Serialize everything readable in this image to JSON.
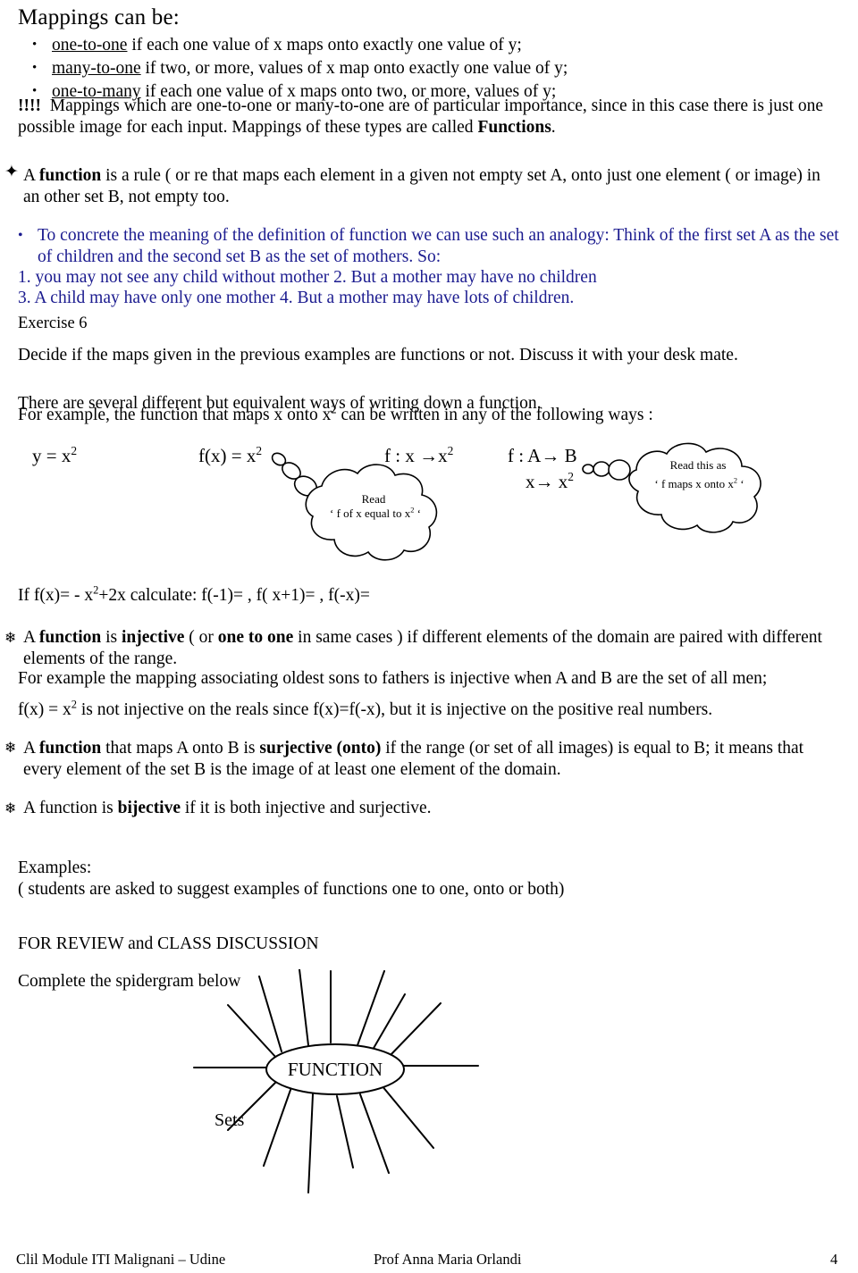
{
  "document": {
    "heading": "Mappings can be:",
    "mapping_bullets": [
      {
        "term": "one-to-one",
        "rest": " if each one value of x maps onto exactly one value of y;"
      },
      {
        "term": "many-to-one",
        "rest": " if two, or more, values of x map onto exactly one value of y;"
      },
      {
        "term": "one-to-many",
        "rest": " if each one value of x maps onto two, or more, values of y;"
      }
    ],
    "importance_note": {
      "prefix": "!!!!",
      "text_a": "Mappings which are one-to-one or many-to-one are of particular importance, since in this case there is just one possible image for each input. Mappings of these types are called ",
      "bold_word": "Functions",
      "text_b": "."
    },
    "function_definition": {
      "marker": "star-icon",
      "lead": "A ",
      "bold_word": "function",
      "text": " is a rule ( or re that maps each element in a given not empty set A, onto just one element ( or image) in an other set B, not empty too."
    },
    "analogy": {
      "bullet_text": "To concrete the meaning of the definition of function we can use such an analogy: Think of the first set A as the set of children and the second set B as the set of mothers.   So:",
      "points_line1": "1. you may not see any child without mother    2. But a mother may have no children",
      "points_line2": "3. A child may have only one mother   4. But a mother may have lots of children."
    },
    "exercise": {
      "label": "Exercise 6",
      "instruction": "Decide if the maps given in the previous examples are functions or not. Discuss it with your desk mate."
    },
    "ways_of_writing": {
      "line1": "There are several different but equivalent ways of writing down a function.",
      "line2_a": "For example, the function that maps x onto x",
      "line2_sup": "2",
      "line2_b": " can be written in any of the following ways :"
    },
    "notations": {
      "n1_a": "y = x",
      "n1_sup": "2",
      "n2_a": "f(x) = x",
      "n2_sup": "2",
      "n3_a": "f : x →x",
      "n3_sup": "2",
      "n4": "f : A→ B",
      "n5_a": "x→ x",
      "n5_sup": "2"
    },
    "bubbles": {
      "bubble1_line1": "Read",
      "bubble1_line2_a": "‘ f of  x  equal to x",
      "bubble1_line2_sup": "2",
      "bubble1_line2_b": " ‘",
      "bubble2_line1": "Read this as",
      "bubble2_line2_a": "‘ f maps x onto x",
      "bubble2_line2_sup": "2",
      "bubble2_line2_b": " ‘"
    },
    "calculate_task": {
      "a": "If f(x)= - x",
      "sup1": "2",
      "b": "+2x  calculate:  f(-1)=         , f(  x+1)=            ,   f(-x)="
    },
    "injective": {
      "marker": "flower-icon",
      "p1_a": "A ",
      "p1_bold1": "function",
      "p1_b": " is ",
      "p1_bold2": "injective",
      "p1_c": " ( or ",
      "p1_bold3": "one to one",
      "p1_d": " in same cases )  if different elements of the domain are paired with different elements of the range.",
      "p2": "For example the mapping associating oldest sons to fathers is injective  when A and B are the set of all men;",
      "p3_a": "f(x) = x",
      "p3_sup": "2",
      "p3_b": " is not injective  on the reals since f(x)=f(-x), but it is injective on the positive real numbers."
    },
    "surjective": {
      "marker": "flower-icon",
      "a": "A ",
      "bold1": "function",
      "b": "  that maps A onto B is ",
      "bold2": "surjective",
      "c": "  ",
      "bold3": "(onto)",
      "d": " if  the range (or set of all images) is equal to B; it means that every element of the set B is the image of at least one element of the domain."
    },
    "bijective": {
      "marker": "flower-icon",
      "a": "A function is ",
      "bold1": "bijective",
      "b": "  if  it is both injective and surjective."
    },
    "examples": {
      "label": "Examples:",
      "text": "( students are asked to suggest examples of functions one to one, onto or both)"
    },
    "review": {
      "heading": "FOR REVIEW and CLASS DISCUSSION",
      "instruction": "Complete the spidergram below"
    },
    "spidergram": {
      "center_label": "FUNCTION",
      "branch_label": "Sets"
    },
    "footer": {
      "left": "Clil  Module   ITI  Malignani – Udine",
      "center": "Prof Anna Maria Orlandi",
      "page_number": "4"
    },
    "colors": {
      "text": "#000000",
      "accent_blue": "#1b1b8f",
      "background": "#ffffff"
    }
  }
}
